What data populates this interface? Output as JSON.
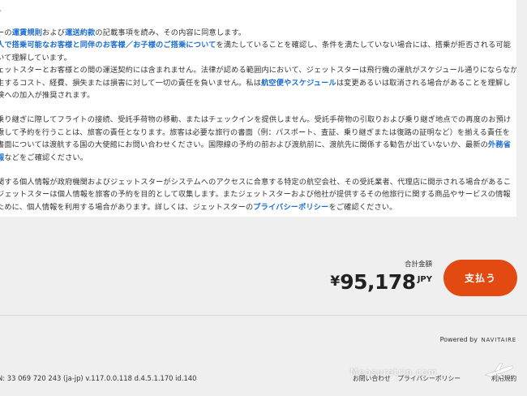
{
  "terms": {
    "top_fragment": "る。",
    "p1": [
      [
        {
          "t": "ーの"
        },
        {
          "t": "運賃規則",
          "link": true
        },
        {
          "t": "および"
        },
        {
          "t": "運送約款",
          "link": true
        },
        {
          "t": "の記載事項を読み、その内容に同意します。"
        }
      ],
      [
        {
          "t": "人で搭乗可能なお客様と同伴のお客様／お子様のご搭乗について",
          "link": true
        },
        {
          "t": "を満たしていることを確認し、条件を満たしていない場合には、搭乗が拒否される可能"
        }
      ],
      [
        {
          "t": "いて理解しています。"
        }
      ],
      [
        {
          "t": "ェットスターとお客様との間の運送契約には含まれません。法律が認める範囲内において、ジェットスターは飛行機の運航がスケジュール通りにならなか"
        }
      ],
      [
        {
          "t": "生するコスト、経費、損失または損害に対して一切の責任を負いません。私は"
        },
        {
          "t": "航空便やスケジュール",
          "link": true
        },
        {
          "t": "は変更あるいは取消される場合があることを理解し"
        }
      ],
      [
        {
          "t": "険への加入が推奨されます。"
        }
      ]
    ],
    "p2": [
      [
        {
          "t": "乗り継ぎに際してフライトの接続、受託手荷物の移動、またはチェックインを提供しません。受託手荷物の引取りおよび乗り継ぎ地点での再度のお預け"
        }
      ],
      [
        {
          "t": "慮して予約を行うことは、旅客の責任となります。旅客は必要な旅行の書面（例：パスポート、査証、乗り継ぎまたは復路の証明など）を揃える責任を"
        }
      ],
      [
        {
          "t": "書面については渡航する国の大使館にお問い合わせください。国際線の予約の前および渡航前に、渡航先に関係する勧告が出ていないか、最新の"
        },
        {
          "t": "外務省",
          "link": true
        }
      ],
      [
        {
          "t": "報",
          "link": true
        },
        {
          "t": "などをご確認ください。"
        }
      ]
    ],
    "p3": [
      [
        {
          "t": "関する個人情報が政府機関およびジェットスターがシステムへのアクセスに合意する特定の航空会社、その受託業者、代理店に開示される場合があるこ"
        }
      ],
      [
        {
          "t": "ジェットスターは個人情報を旅客の予約を目的として収集します。またジェットスターおよび他社が提供するその他旅行に関する商品やサービスの情報"
        }
      ],
      [
        {
          "t": "ために、個人情報を利用する場合があります。詳しくは、ジェットスターの"
        },
        {
          "t": "プライバシーポリシー",
          "link": true
        },
        {
          "t": "をご確認ください。"
        }
      ]
    ]
  },
  "payment": {
    "total_label": "合計金額",
    "currency_symbol": "¥",
    "amount": "95,178",
    "currency_code": "JPY",
    "pay_button_label": "支払う",
    "accent_color": "#e24a12"
  },
  "footer": {
    "powered_by": "Powered by",
    "powered_brand": "NAVITAIRE",
    "build_info": "N: 33 069 720 243 (ja-jp) v.117.0.0.118 d.4.5.1.170 id.140",
    "links": [
      "お問い合わせ",
      "プライバシーポリシー"
    ],
    "terms_link": "利用規約",
    "watermark": "Measuretrip.com"
  }
}
